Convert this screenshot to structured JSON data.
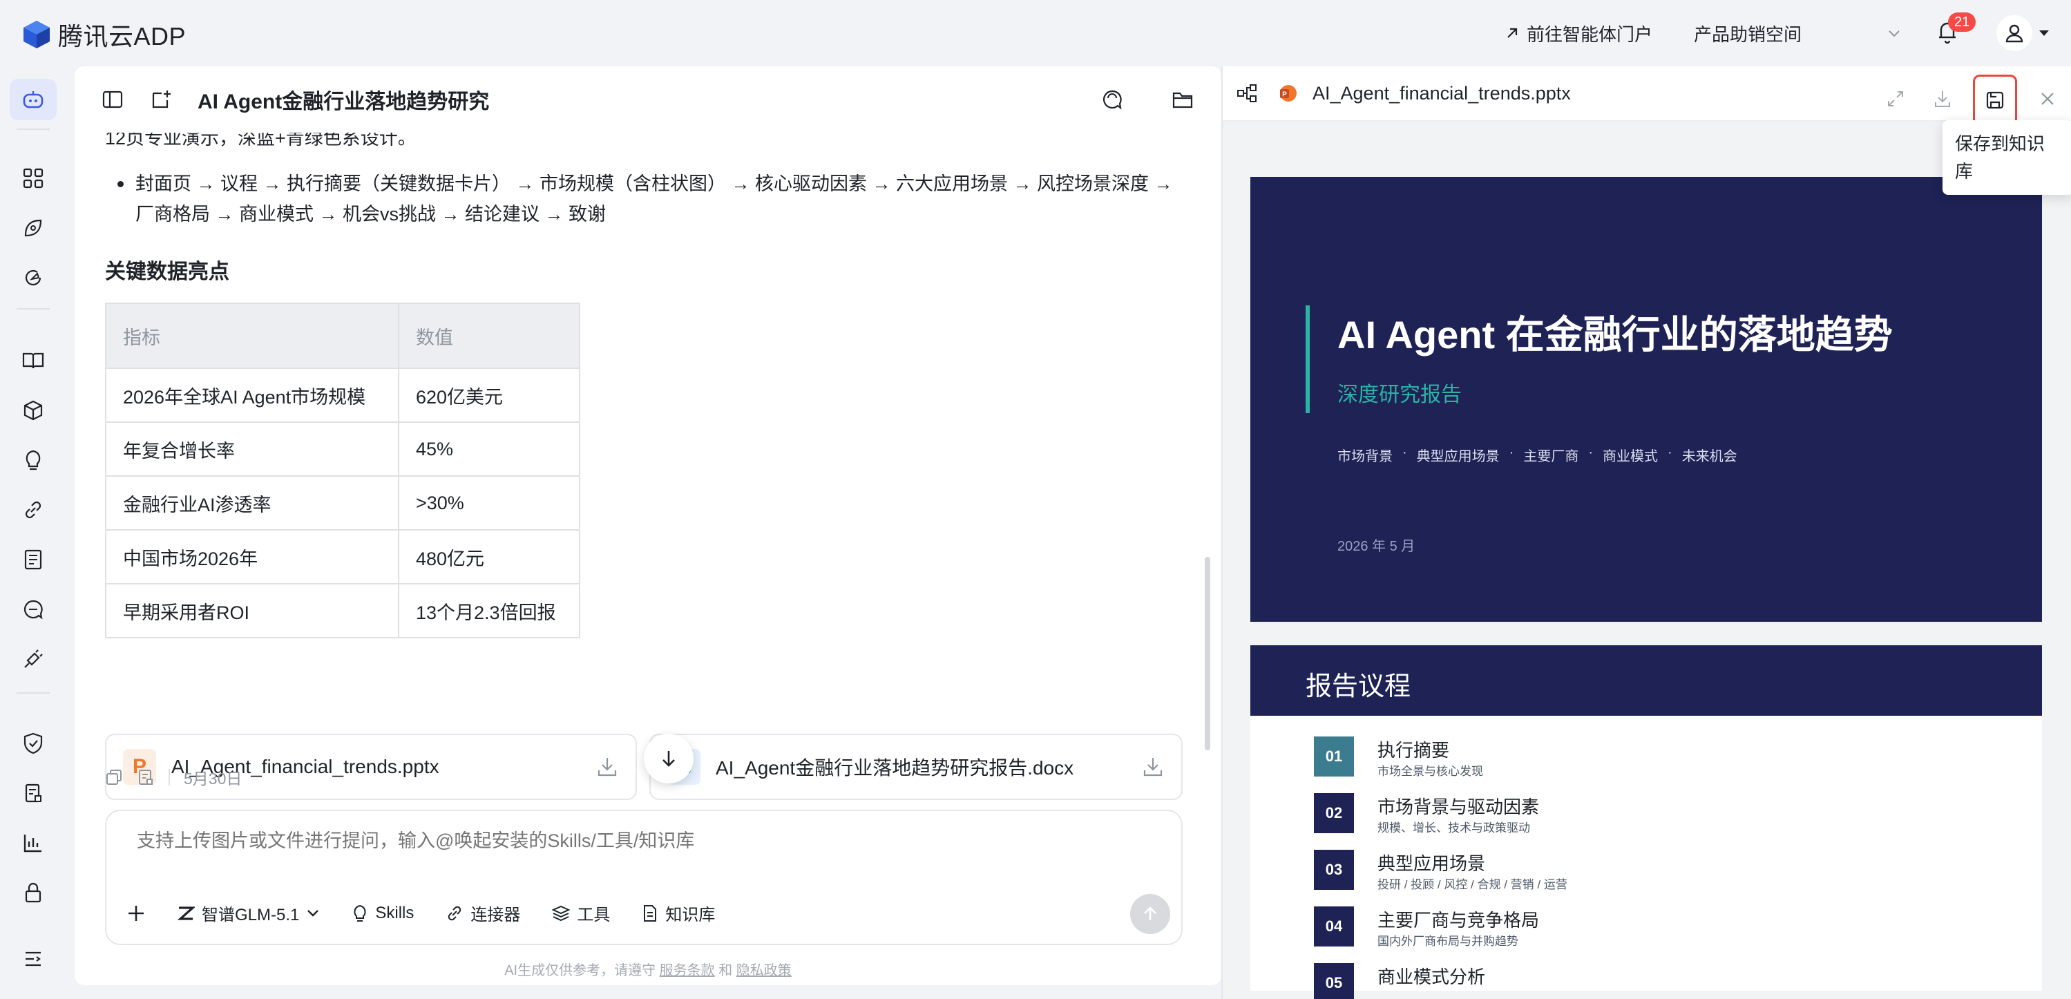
{
  "app": {
    "logo_text": "腾讯云ADP"
  },
  "topbar": {
    "portal_link": "前往智能体门户",
    "product_select": "产品助销空间",
    "notification_count": "21"
  },
  "chat": {
    "title": "AI Agent金融行业落地趋势研究",
    "partial_line": "12页专业演示，深蓝+青绿色系设计。",
    "outline": "封面页 → 议程 → 执行摘要（关键数据卡片） → 市场规模（含柱状图） → 核心驱动因素 → 六大应用场景 → 风控场景深度 → 厂商格局 → 商业模式 → 机会vs挑战 → 结论建议 → 致谢",
    "section_title": "关键数据亮点",
    "table": {
      "headers": [
        "指标",
        "数值"
      ],
      "rows": [
        [
          "2026年全球AI Agent市场规模",
          "620亿美元"
        ],
        [
          "年复合增长率",
          "45%"
        ],
        [
          "金融行业AI渗透率",
          ">30%"
        ],
        [
          "中国市场2026年",
          "480亿元"
        ],
        [
          "早期采用者ROI",
          "13个月2.3倍回报"
        ]
      ]
    },
    "files": [
      {
        "name": "AI_Agent_financial_trends.pptx",
        "icon": "P"
      },
      {
        "name": "AI_Agent金融行业落地趋势研究报告.docx",
        "icon": "W"
      }
    ],
    "date": "5月30日"
  },
  "composer": {
    "placeholder": "支持上传图片或文件进行提问，输入@唤起安装的Skills/工具/知识库",
    "model": "智谱GLM-5.1",
    "tools": [
      "Skills",
      "连接器",
      "工具",
      "知识库"
    ]
  },
  "disclaimer": {
    "prefix": "AI生成仅供参考，请遵守",
    "terms": "服务条款",
    "and": "和",
    "privacy": "隐私政策"
  },
  "preview": {
    "file_name": "AI_Agent_financial_trends.pptx",
    "tooltip": "保存到知识库",
    "slide1": {
      "title": "AI Agent  在金融行业的落地趋势",
      "subtitle": "深度研究报告",
      "topics": [
        "市场背景",
        "·",
        "典型应用场景",
        "·",
        "主要厂商",
        "·",
        "商业模式",
        "·",
        "未来机会"
      ],
      "date": "2026 年 5 月"
    },
    "slide2": {
      "title": "报告议程",
      "items": [
        {
          "num": "01",
          "title": "执行摘要",
          "desc": "市场全景与核心发现"
        },
        {
          "num": "02",
          "title": "市场背景与驱动因素",
          "desc": "规模、增长、技术与政策驱动"
        },
        {
          "num": "03",
          "title": "典型应用场景",
          "desc": "投研 / 投顾 / 风控 / 合规 / 营销 / 运营"
        },
        {
          "num": "04",
          "title": "主要厂商与竞争格局",
          "desc": "国内外厂商布局与并购趋势"
        },
        {
          "num": "05",
          "title": "商业模式分析",
          "desc": ""
        }
      ]
    }
  },
  "colors": {
    "slide_navy": "#1e2254",
    "slide_teal": "#2bb3a4",
    "highlight_red": "#e8473a",
    "badge_red": "#f54a45",
    "ppt_orange": "#f0772a",
    "word_blue": "#2c7be5"
  }
}
